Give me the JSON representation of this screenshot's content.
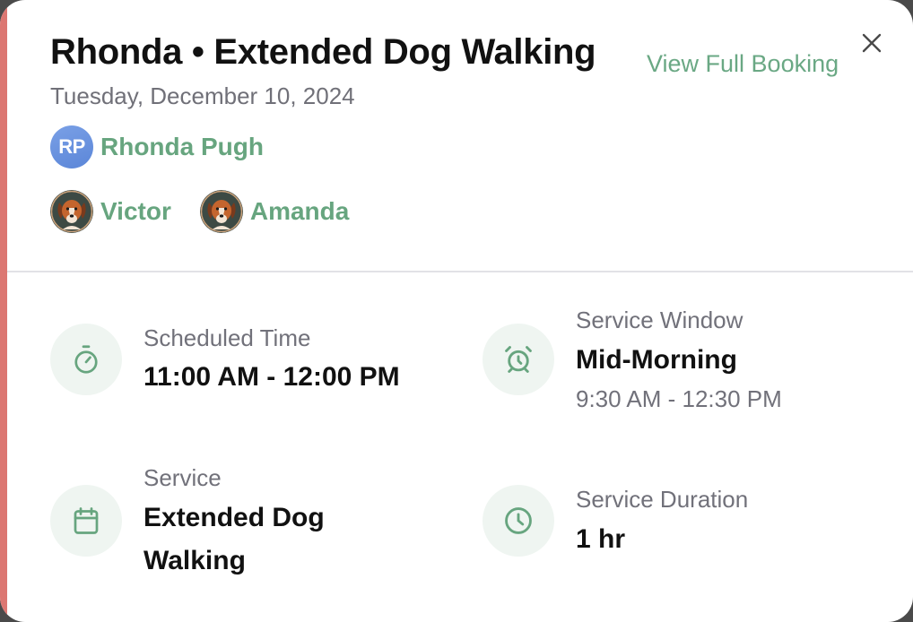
{
  "header": {
    "client_first_name": "Rhonda",
    "separator": "•",
    "service_name": "Extended Dog Walking",
    "title": "Rhonda • Extended Dog Walking",
    "date": "Tuesday, December 10, 2024",
    "view_full_booking_label": "View Full Booking",
    "close_icon": "close-icon"
  },
  "client": {
    "initials": "RP",
    "name": "Rhonda Pugh",
    "avatar_color": "#6b93de"
  },
  "pets": [
    {
      "name": "Victor",
      "avatar": "dog-avatar"
    },
    {
      "name": "Amanda",
      "avatar": "dog-avatar"
    }
  ],
  "details": {
    "scheduled_time": {
      "label": "Scheduled Time",
      "value": "11:00 AM - 12:00 PM",
      "icon": "stopwatch-icon"
    },
    "service_window": {
      "label": "Service Window",
      "value": "Mid-Morning",
      "sub": "9:30 AM - 12:30 PM",
      "icon": "alarm-clock-icon"
    },
    "service": {
      "label": "Service",
      "value_line1": "Extended Dog",
      "value_line2": "Walking",
      "icon": "calendar-icon"
    },
    "service_duration": {
      "label": "Service Duration",
      "value": "1 hr",
      "icon": "clock-icon"
    }
  },
  "colors": {
    "accent_bar": "#dc7772",
    "brand_green": "#67a57f",
    "icon_bg": "#eff5f1",
    "muted_text": "#71717a"
  }
}
